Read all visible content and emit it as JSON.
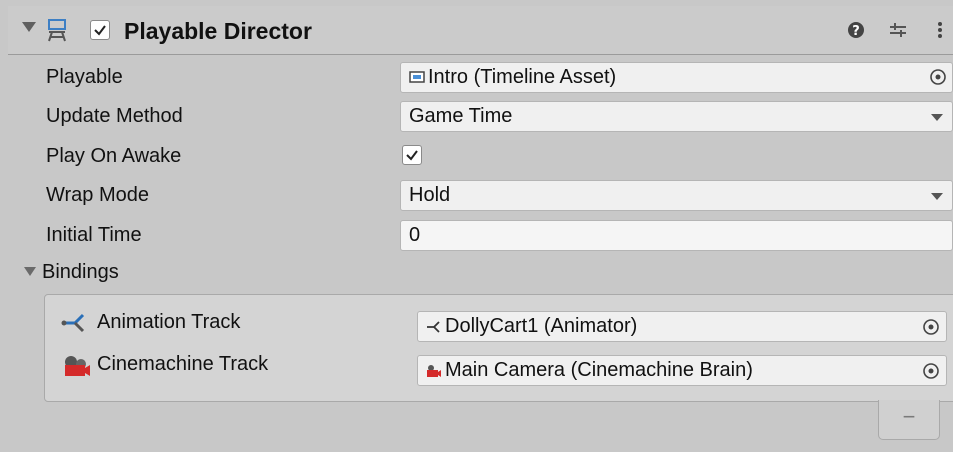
{
  "component": {
    "title": "Playable Director",
    "enabled": true,
    "icon": "director-icon",
    "header_buttons": [
      "help-icon",
      "presets-icon",
      "more-icon"
    ]
  },
  "properties": {
    "playable": {
      "label": "Playable",
      "value": "Intro (Timeline Asset)"
    },
    "update_method": {
      "label": "Update Method",
      "value": "Game Time"
    },
    "play_on_awake": {
      "label": "Play On Awake",
      "checked": true
    },
    "wrap_mode": {
      "label": "Wrap Mode",
      "value": "Hold"
    },
    "initial_time": {
      "label": "Initial Time",
      "value": "0"
    }
  },
  "bindings": {
    "label": "Bindings",
    "items": [
      {
        "track": "Animation Track",
        "track_icon": "animation-track-icon",
        "object": "DollyCart1 (Animator)"
      },
      {
        "track": "Cinemachine Track",
        "track_icon": "cinemachine-track-icon",
        "object": "Main Camera (Cinemachine Brain)"
      }
    ],
    "remove_label": "−"
  },
  "colors": {
    "background": "#c8c8c8",
    "field": "#f0f0f0",
    "cinemachine_red": "#d42a2a",
    "animation_blue": "#2a6fb8"
  }
}
